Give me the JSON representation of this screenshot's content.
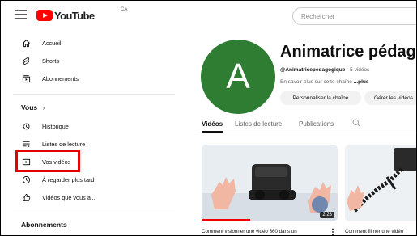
{
  "header": {
    "logo_text": "YouTube",
    "region": "CA",
    "search_placeholder": "Rechercher"
  },
  "sidebar": {
    "main": [
      {
        "label": "Accueil",
        "icon": "home-icon"
      },
      {
        "label": "Shorts",
        "icon": "shorts-icon"
      },
      {
        "label": "Abonnements",
        "icon": "subscriptions-icon"
      }
    ],
    "you_section": "Vous",
    "you_chevron": "›",
    "you_items": [
      {
        "label": "Historique",
        "icon": "history-icon"
      },
      {
        "label": "Listes de lecture",
        "icon": "playlist-icon"
      },
      {
        "label": "Vos vidéos",
        "icon": "your-videos-icon"
      },
      {
        "label": "À regarder plus tard",
        "icon": "watch-later-icon"
      },
      {
        "label": "Vidéos que vous ai...",
        "icon": "liked-icon"
      }
    ],
    "subs_section": "Abonnements"
  },
  "channel": {
    "avatar_letter": "A",
    "avatar_color": "#2e7d32",
    "name": "Animatrice pédagogique",
    "handle": "@Animatricepedagogique",
    "video_count": "· 5 vidéos",
    "about_text": "En savoir plus sur cette chaîne",
    "about_more": "...plus",
    "customize_label": "Personnaliser la chaîne",
    "manage_label": "Gérer les vidéos"
  },
  "tabs": [
    "Vidéos",
    "Listes de lecture",
    "Publications"
  ],
  "videos": [
    {
      "title": "Comment visionner une vidéo 360 dans un",
      "duration": "2:23"
    },
    {
      "title": "Comment filmer une vidéo",
      "duration": ""
    }
  ],
  "highlight_color": "#e60000"
}
